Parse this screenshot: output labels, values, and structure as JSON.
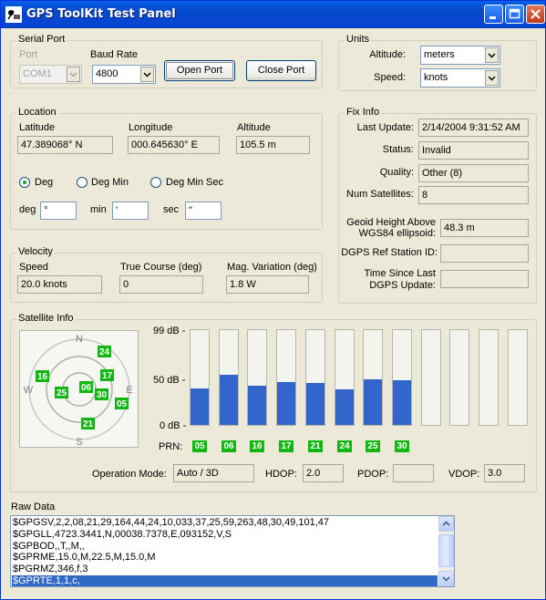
{
  "window": {
    "title": "GPS ToolKit Test Panel"
  },
  "serial": {
    "legend": "Serial Port",
    "port_label": "Port",
    "port_value": "COM1",
    "baud_label": "Baud Rate",
    "baud_value": "4800",
    "open_label": "Open Port",
    "close_label": "Close Port"
  },
  "units": {
    "legend": "Units",
    "altitude_label": "Altitude:",
    "altitude_value": "meters",
    "speed_label": "Speed:",
    "speed_value": "knots"
  },
  "location": {
    "legend": "Location",
    "lat_label": "Latitude",
    "lat_value": "47.389068°  N",
    "lon_label": "Longitude",
    "lon_value": "000.645630°  E",
    "alt_label": "Altitude",
    "alt_value": "105.5 m",
    "fmt_deg": "Deg",
    "fmt_degmin": "Deg Min",
    "fmt_degminsec": "Deg Min Sec",
    "deg_label": "deg",
    "deg_value": "°",
    "min_label": "min",
    "min_value": "'",
    "sec_label": "sec",
    "sec_value": "\""
  },
  "velocity": {
    "legend": "Velocity",
    "speed_label": "Speed",
    "speed_value": "20.0 knots",
    "course_label": "True Course (deg)",
    "course_value": "0",
    "magvar_label": "Mag. Variation (deg)",
    "magvar_value": "1.8 W"
  },
  "fix": {
    "legend": "Fix Info",
    "last_update_label": "Last Update:",
    "last_update_value": "2/14/2004 9:31:52 AM",
    "status_label": "Status:",
    "status_value": "Invalid",
    "quality_label": "Quality:",
    "quality_value": "Other (8)",
    "numsat_label": "Num Satellites:",
    "numsat_value": "8",
    "geoid_label_1": "Geoid Height Above",
    "geoid_label_2": "WGS84 ellipsoid:",
    "geoid_value": "48.3 m",
    "dgps_label": "DGPS Ref Station ID:",
    "dgps_value": "",
    "since_label_1": "Time Since Last",
    "since_label_2": "DGPS Update:",
    "since_value": ""
  },
  "satinfo": {
    "legend": "Satellite Info",
    "compass": {
      "n": "N",
      "s": "S",
      "e": "E",
      "w": "W"
    },
    "sky_sats": [
      "24",
      "16",
      "17",
      "25",
      "06",
      "30",
      "05",
      "21"
    ],
    "db_labels": {
      "top": "99 dB -",
      "mid": "50 dB -",
      "bottom": "0 dB -"
    },
    "prn_label": "PRN:",
    "snr_scale_max": 99,
    "bars": [
      {
        "prn": "05",
        "snr": 38
      },
      {
        "prn": "06",
        "snr": 52
      },
      {
        "prn": "16",
        "snr": 41
      },
      {
        "prn": "17",
        "snr": 45
      },
      {
        "prn": "21",
        "snr": 44
      },
      {
        "prn": "24",
        "snr": 37
      },
      {
        "prn": "25",
        "snr": 48
      },
      {
        "prn": "30",
        "snr": 47
      },
      {
        "prn": "",
        "snr": 0
      },
      {
        "prn": "",
        "snr": 0
      },
      {
        "prn": "",
        "snr": 0
      },
      {
        "prn": "",
        "snr": 0
      }
    ],
    "opmode_label": "Operation Mode:",
    "opmode_value": "Auto / 3D",
    "hdop_label": "HDOP:",
    "hdop_value": "2.0",
    "pdop_label": "PDOP:",
    "pdop_value": "",
    "vdop_label": "VDOP:",
    "vdop_value": "3.0"
  },
  "raw": {
    "label": "Raw Data",
    "lines": [
      "$GPGSV,2,2,08,21,29,164,44,24,10,033,37,25,59,263,48,30,49,101,47",
      "$GPGLL,4723.3441,N,00038.7378,E,093152,V,S",
      "$GPBOD,,T,,M,,",
      "$GPRME,15.0,M,22.5,M,15.0,M",
      "$PGRMZ,346,f,3",
      "$GPRTE,1,1,c,"
    ],
    "selected_index": 5
  },
  "colors": {
    "accent": "#316ac5",
    "titlebar": "#0548c8",
    "satellite": "#11b711",
    "bar": "#3366cc"
  }
}
